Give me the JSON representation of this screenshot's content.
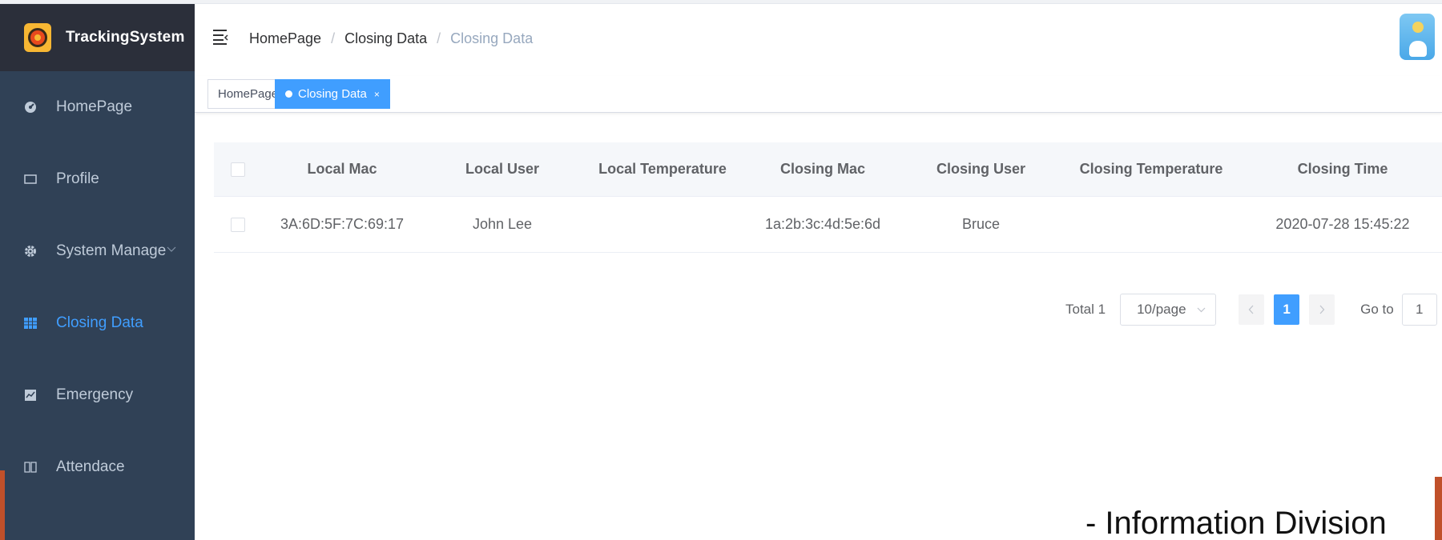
{
  "app": {
    "title": "TrackingSystem"
  },
  "sidebar": {
    "items": [
      {
        "label": "HomePage",
        "icon": "dashboard-icon"
      },
      {
        "label": "Profile",
        "icon": "card-icon"
      },
      {
        "label": "System Manage",
        "icon": "gear-icon"
      },
      {
        "label": "Closing Data",
        "icon": "grid-icon",
        "active": true
      },
      {
        "label": "Emergency",
        "icon": "chart-icon"
      },
      {
        "label": "Attendace",
        "icon": "book-icon"
      }
    ]
  },
  "breadcrumb": [
    "HomePage",
    "Closing Data",
    "Closing Data"
  ],
  "tags": [
    {
      "label": "HomePage"
    },
    {
      "label": "Closing Data",
      "active": true,
      "close": "×"
    }
  ],
  "table": {
    "columns": [
      "Local Mac",
      "Local User",
      "Local Temperature",
      "Closing Mac",
      "Closing User",
      "Closing Temperature",
      "Closing Time"
    ],
    "rows": [
      [
        "3A:6D:5F:7C:69:17",
        "John Lee",
        "",
        "1a:2b:3c:4d:5e:6d",
        "Bruce",
        "",
        "2020-07-28 15:45:22"
      ]
    ]
  },
  "pagination": {
    "total": "Total 1",
    "page_size": "10/page",
    "current_page": "1",
    "goto_label": "Go to",
    "goto_value": "1"
  },
  "footer": {
    "text": "- Information Division"
  },
  "colors": {
    "sidebar_bg": "#304156",
    "brand_bg": "#2b2f3a",
    "accent": "#409eff",
    "slide_accent": "#c0502a"
  }
}
